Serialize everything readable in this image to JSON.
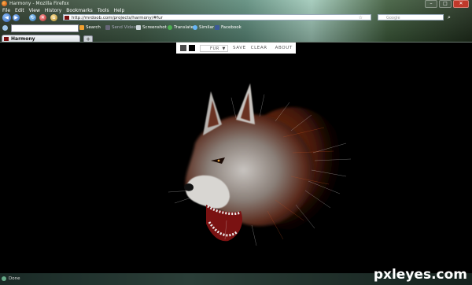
{
  "window": {
    "title": "Harmony - Mozilla Firefox",
    "controls": [
      "–",
      "□",
      "✕"
    ]
  },
  "menu": [
    "File",
    "Edit",
    "View",
    "History",
    "Bookmarks",
    "Tools",
    "Help"
  ],
  "nav": {
    "url": "http://mrdoob.com/projects/harmony/#fur",
    "search_placeholder": "Google"
  },
  "toolbar": {
    "search_label": "Search",
    "send_video": "Send Video",
    "screenshot": "Screenshot",
    "translate": "Translate",
    "similar": "Similar",
    "facebook": "Facebook"
  },
  "tab": {
    "label": "Harmony",
    "new_tab": "+"
  },
  "harmony_tools": {
    "foreground_color": "#4a4a4a",
    "background_color": "#000000",
    "brush": "FUR",
    "save": "SAVE",
    "clear": "CLEAR",
    "about": "ABOUT"
  },
  "status": {
    "text": "Done"
  },
  "watermark": "pxleyes.com"
}
